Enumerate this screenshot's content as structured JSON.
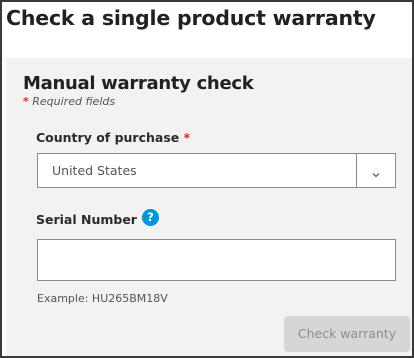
{
  "page": {
    "title": "Check a single product warranty"
  },
  "form": {
    "section_title": "Manual warranty check",
    "required_marker": "*",
    "required_note": "Required fields",
    "country": {
      "label": "Country of purchase",
      "required_marker": "*",
      "selected_value": "United States",
      "dropdown_icon": "chevron-down-icon"
    },
    "serial": {
      "label": "Serial Number",
      "required_marker": "*",
      "help_icon_text": "?",
      "value": "",
      "example": "Example: HU265BM18V"
    },
    "submit": {
      "label": "Check warranty",
      "state": "disabled"
    }
  },
  "colors": {
    "accent_blue": "#0096d6",
    "required_red": "#d7262e",
    "panel_bg": "#f2f2f2",
    "disabled_button_bg": "#d6d6d6"
  }
}
